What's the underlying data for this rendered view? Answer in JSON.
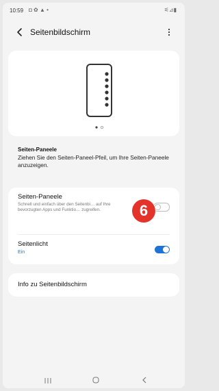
{
  "status_bar": {
    "time": "10:59",
    "left_icons": "◘ ✿ ▲ •",
    "right_icons": "⚟⊿▮"
  },
  "app_bar": {
    "title": "Seitenbildschirm",
    "back_icon": "chevron-left-icon",
    "more_icon": "more-vertical-icon"
  },
  "description": {
    "title": "Seiten-Paneele",
    "body": "Ziehen Sie den Seiten-Paneel-Pfeil, um Ihre Seiten-Paneele anzuzeigen."
  },
  "settings": {
    "seiten_paneele": {
      "title": "Seiten-Paneele",
      "summary": "Schnell und einfach über den Seitenbi… auf Ihre bevorzugten Apps und Funktio… zugreifen.",
      "enabled": false
    },
    "seitenlicht": {
      "title": "Seitenlicht",
      "status": "Ein",
      "enabled": true
    }
  },
  "info_item": {
    "label": "Info zu Seitenbildschirm"
  },
  "step_badge": {
    "number": "6",
    "color": "#e4332b"
  },
  "accent_color": "#1e74d6",
  "nav_bar": {
    "icons": [
      "recents-icon",
      "home-icon",
      "back-icon"
    ]
  }
}
